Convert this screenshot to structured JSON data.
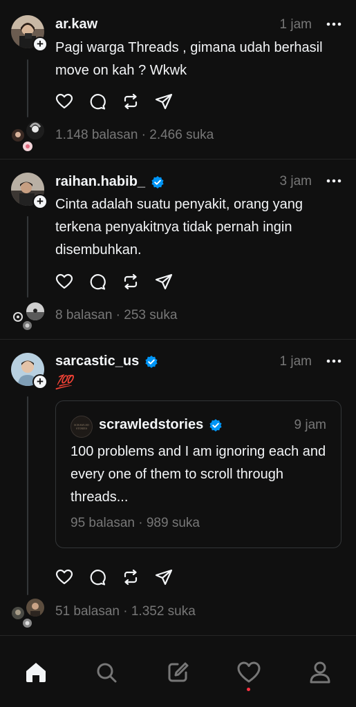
{
  "posts": [
    {
      "username": "ar.kaw",
      "verified": false,
      "time": "1 jam",
      "text": "Pagi warga Threads , gimana udah berhasil move on kah ? Wkwk",
      "stats": "1.148 balasan · 2.466 suka"
    },
    {
      "username": "raihan.habib_",
      "verified": true,
      "time": "3 jam",
      "text": "Cinta adalah suatu penyakit, orang yang terkena penyakitnya tidak pernah ingin disembuhkan.",
      "stats": "8 balasan · 253 suka"
    },
    {
      "username": "sarcastic_us",
      "verified": true,
      "time": "1 jam",
      "text": "💯",
      "stats": "51 balasan · 1.352 suka",
      "quote": {
        "username": "scrawledstories",
        "verified": true,
        "time": "9 jam",
        "text": "100 problems and I am ignoring each and every one of them to scroll through threads...",
        "stats": "95 balasan · 989 suka",
        "avatar_text": "SCRAWLED STORIES"
      }
    }
  ],
  "nav": {
    "items": [
      "home-icon",
      "search-icon",
      "compose-icon",
      "heart-icon",
      "profile-icon"
    ],
    "active": "home-icon",
    "notification_dot_color": "#ff3040"
  },
  "colors": {
    "background": "#101010",
    "text": "#f3f5f7",
    "muted": "#777777",
    "verified": "#0095f6",
    "divider": "#262626"
  }
}
